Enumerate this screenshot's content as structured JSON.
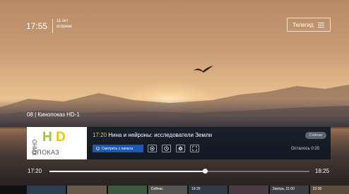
{
  "status_bar": {
    "time": "17:55",
    "date_day": "11 окт",
    "date_weekday": "вторник"
  },
  "guide_button": {
    "label": "Телегид",
    "icon": "menu-icon"
  },
  "channel": {
    "label": "08 | Кинопоказ HD-1"
  },
  "logo": {
    "vertical_text": "КИНО",
    "big_h": "H",
    "big_d": "D",
    "bottom_text": "ОПОКАЗ"
  },
  "program": {
    "start_time": "17:20",
    "title": "Нина и нейроны: исследователи Земли",
    "now_badge": "Сейчас",
    "restart_label": "Смотреть с начала",
    "remaining": "Осталось 0:25",
    "controls": [
      "record-icon",
      "clock-icon",
      "settings-icon",
      "fullscreen-icon"
    ]
  },
  "timeline": {
    "start": "17:20",
    "end": "18:25",
    "progress": 0.6
  },
  "thumbnails": [
    {
      "label": "",
      "color": "#2b3d52"
    },
    {
      "label": "",
      "color": "#6b5a4a"
    },
    {
      "label": "",
      "color": "#3b5a3f"
    },
    {
      "label": "Сейчас",
      "color": "#555555"
    },
    {
      "label": "19:20",
      "color": "#2f3a49"
    },
    {
      "label": "",
      "color": "#4a3b45"
    },
    {
      "label": "Завтра, 21:00",
      "color": "#3d3f45"
    },
    {
      "label": "22:30",
      "color": "#5a4d3a"
    }
  ]
}
